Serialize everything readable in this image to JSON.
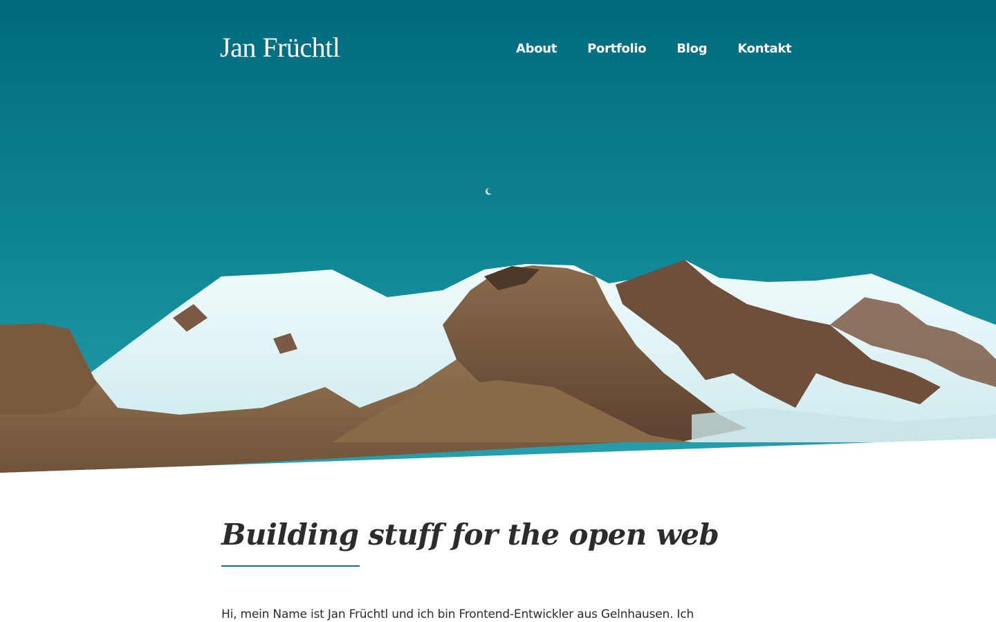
{
  "site": {
    "logo": "Jan Früchtl"
  },
  "nav": {
    "items": [
      {
        "label": "About"
      },
      {
        "label": "Portfolio"
      },
      {
        "label": "Blog"
      },
      {
        "label": "Kontakt"
      }
    ]
  },
  "hero": {
    "image": "snow-capped-mountains-under-blue-sky-with-moon"
  },
  "main": {
    "headline": "Building stuff for the open web",
    "intro": "Hi, mein Name ist Jan Früchtl und ich bin Frontend-Entwickler aus Gelnhausen. Ich"
  },
  "colors": {
    "sky_top": "#006b80",
    "sky_bottom": "#1a90a0",
    "accent_rule": "#1f6a82",
    "text": "#2c2c2c",
    "nav_text": "#ffffff"
  }
}
